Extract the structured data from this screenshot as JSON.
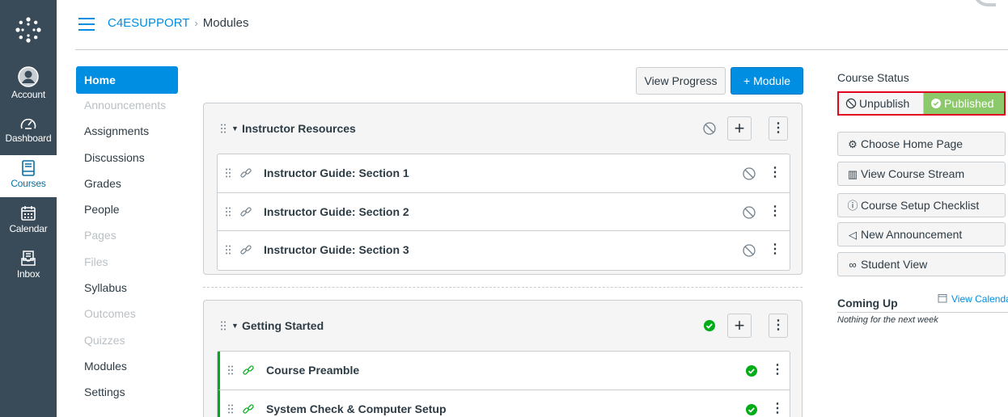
{
  "global_nav": {
    "items": [
      {
        "label": "Account",
        "icon": "user-icon"
      },
      {
        "label": "Dashboard",
        "icon": "dashboard-icon"
      },
      {
        "label": "Courses",
        "icon": "book-icon",
        "active": true
      },
      {
        "label": "Calendar",
        "icon": "calendar-icon"
      },
      {
        "label": "Inbox",
        "icon": "inbox-icon"
      }
    ]
  },
  "breadcrumb": {
    "course": "C4ESUPPORT",
    "separator": "›",
    "current": "Modules"
  },
  "course_nav": {
    "items": [
      {
        "label": "Home",
        "state": "active"
      },
      {
        "label": "Announcements",
        "state": "disabled"
      },
      {
        "label": "Assignments",
        "state": "enabled"
      },
      {
        "label": "Discussions",
        "state": "enabled"
      },
      {
        "label": "Grades",
        "state": "enabled"
      },
      {
        "label": "People",
        "state": "enabled"
      },
      {
        "label": "Pages",
        "state": "disabled"
      },
      {
        "label": "Files",
        "state": "disabled"
      },
      {
        "label": "Syllabus",
        "state": "enabled"
      },
      {
        "label": "Outcomes",
        "state": "disabled"
      },
      {
        "label": "Quizzes",
        "state": "disabled"
      },
      {
        "label": "Modules",
        "state": "enabled"
      },
      {
        "label": "Settings",
        "state": "enabled"
      }
    ]
  },
  "toolbar": {
    "view_progress": "View Progress",
    "add_module": "+ Module"
  },
  "modules": [
    {
      "title": "Instructor Resources",
      "status": "unpublished",
      "items": [
        {
          "title": "Instructor Guide: Section 1",
          "status": "unpublished"
        },
        {
          "title": "Instructor Guide: Section 2",
          "status": "unpublished"
        },
        {
          "title": "Instructor Guide: Section 3",
          "status": "unpublished"
        }
      ]
    },
    {
      "title": "Getting Started",
      "status": "published",
      "items": [
        {
          "title": "Course Preamble",
          "status": "published"
        },
        {
          "title": "System Check & Computer Setup",
          "status": "published"
        }
      ]
    }
  ],
  "sidebar": {
    "course_status_title": "Course Status",
    "unpublish_label": "Unpublish",
    "published_label": "Published",
    "buttons": [
      {
        "label": "Choose Home Page",
        "icon": "home-page-icon"
      },
      {
        "label": "View Course Stream",
        "icon": "stream-icon"
      },
      {
        "label": "Course Setup Checklist",
        "icon": "question-icon"
      },
      {
        "label": "New Announcement",
        "icon": "megaphone-icon"
      },
      {
        "label": "Student View",
        "icon": "glasses-icon"
      }
    ],
    "coming_up": "Coming Up",
    "view_calendar": "View Calendar",
    "nothing_next_week": "Nothing for the next week"
  },
  "colors": {
    "brand_blue": "#008ee2",
    "nav_dark": "#394b58",
    "published_green": "#00ac18",
    "published_button": "#8cc96b",
    "highlight_red": "#e0061f"
  }
}
